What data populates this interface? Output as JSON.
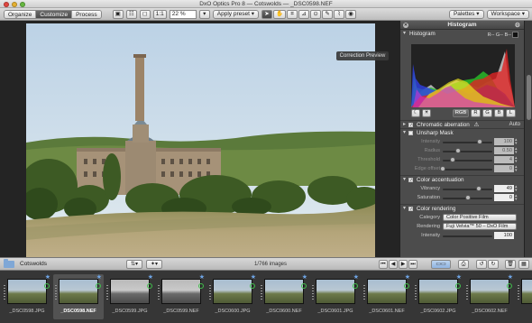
{
  "window": {
    "title": "DxO Optics Pro 8 — Cotswolds — _DSC0598.NEF"
  },
  "toolbar": {
    "tabs": [
      "Organize",
      "Customize",
      "Process"
    ],
    "active_tab": "Customize",
    "ratio_label": "1:1",
    "zoom_value": "22 %",
    "preset_label": "Apply preset",
    "palettes_label": "Palettes",
    "workspace_label": "Workspace"
  },
  "viewer": {
    "tooltip": "Correction Preview"
  },
  "panel": {
    "title": "Histogram",
    "histogram": {
      "section_label": "Histogram",
      "rgb_readout": "R-- G-- B--",
      "buttons": [
        "RGB",
        "R",
        "G",
        "B",
        "L"
      ],
      "active_button": "RGB"
    },
    "chromatic": {
      "label": "Chromatic aberration",
      "mode": "Auto"
    },
    "unsharp": {
      "label": "Unsharp Mask",
      "rows": [
        {
          "label": "Intensity",
          "value": "100",
          "pos": 0.75
        },
        {
          "label": "Radius",
          "value": "0.50",
          "pos": 0.3
        },
        {
          "label": "Threshold",
          "value": "4",
          "pos": 0.2
        },
        {
          "label": "Edge offset",
          "value": "0",
          "pos": 0.0
        }
      ]
    },
    "accentuation": {
      "label": "Color accentuation",
      "rows": [
        {
          "label": "Vibrancy",
          "value": "49",
          "pos": 0.72
        },
        {
          "label": "Saturation",
          "value": "0",
          "pos": 0.5
        }
      ]
    },
    "rendering": {
      "label": "Color rendering",
      "category_label": "Category",
      "category_value": "Color Positive Film",
      "rendering_label": "Rendering",
      "rendering_value": "Fuji Velvia™ 50 – DxO Film",
      "intensity_label": "Intensity",
      "intensity_value": "100"
    }
  },
  "browser": {
    "folder_name": "Cotswolds",
    "image_count": "1/766 images",
    "thumbnails": [
      {
        "name": "_DSC0598.JPG",
        "selected": false,
        "bw": false
      },
      {
        "name": "_DSC0598.NEF",
        "selected": true,
        "bw": false
      },
      {
        "name": "_DSC0599.JPG",
        "selected": false,
        "bw": true
      },
      {
        "name": "_DSC0599.NEF",
        "selected": false,
        "bw": true
      },
      {
        "name": "_DSC0600.JPG",
        "selected": false,
        "bw": false
      },
      {
        "name": "_DSC0600.NEF",
        "selected": false,
        "bw": false
      },
      {
        "name": "_DSC0601.JPG",
        "selected": false,
        "bw": false
      },
      {
        "name": "_DSC0601.NEF",
        "selected": false,
        "bw": false
      },
      {
        "name": "_DSC0602.JPG",
        "selected": false,
        "bw": false
      },
      {
        "name": "_DSC0602.NEF",
        "selected": false,
        "bw": false
      },
      {
        "name": "",
        "selected": false,
        "bw": false
      }
    ]
  },
  "colors": {
    "accent": "#6fa5e6",
    "ok": "#3fc04a",
    "panel_bg": "#4c4c4c"
  },
  "icons": [
    "pointer-icon",
    "hand-icon",
    "crop-icon",
    "straighten-icon",
    "picker-icon",
    "brush-icon",
    "repair-icon",
    "red-eye-icon",
    "folder-icon",
    "star-icon",
    "processed-icon"
  ]
}
